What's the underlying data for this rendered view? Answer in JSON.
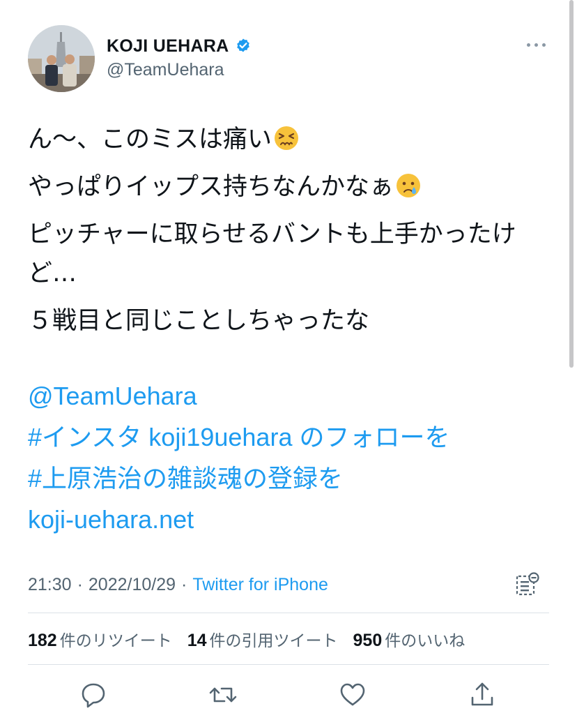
{
  "author": {
    "display_name": "KOJI  UEHARA",
    "handle": "@TeamUehara",
    "verified": true
  },
  "tweet": {
    "lines": [
      "ん〜、このミスは痛い",
      "やっぱりイップス持ちなんかなぁ",
      "ピッチャーに取らせるバントも上手かったけど…",
      "５戦目と同じことしちゃったな"
    ],
    "emojis": [
      "persevering-face",
      "crying-face"
    ],
    "links": [
      "@TeamUehara",
      "#インスタ koji19uehara のフォローを",
      "#上原浩治の雑談魂の登録を",
      "koji-uehara.net"
    ]
  },
  "meta": {
    "time": "21:30",
    "separator": "·",
    "date": "2022/10/29",
    "source": "Twitter for iPhone"
  },
  "stats": {
    "retweets_count": "182",
    "retweets_label": "件のリツイート",
    "quotes_count": "14",
    "quotes_label": "件の引用ツイート",
    "likes_count": "950",
    "likes_label": "件のいいね"
  },
  "colors": {
    "accent": "#1d9bf0",
    "secondary_text": "#536471",
    "divider": "#dbe1e6"
  },
  "icons": {
    "more": "more-horizontal-icon",
    "verified": "verified-badge-icon",
    "analytics": "view-activity-icon",
    "reply": "reply-icon",
    "retweet": "retweet-icon",
    "like": "heart-icon",
    "share": "share-icon"
  }
}
